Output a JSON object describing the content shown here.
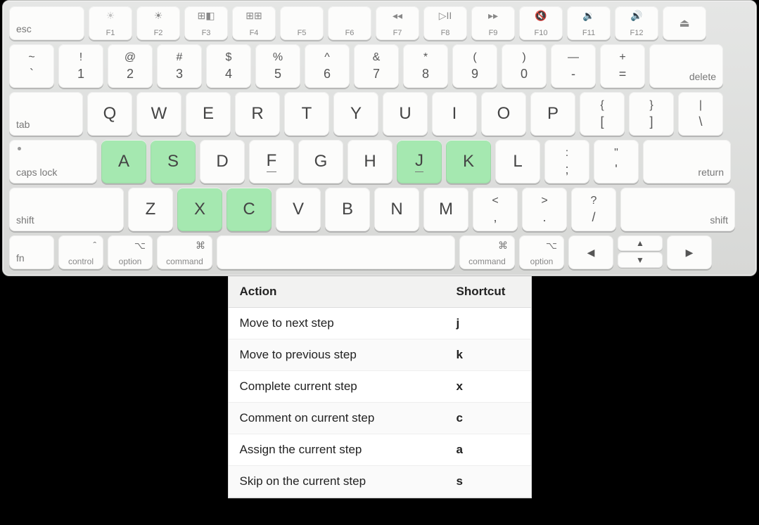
{
  "fn_row": {
    "esc": "esc",
    "keys": [
      {
        "g": "☀︎",
        "dim": true,
        "l": "F1"
      },
      {
        "g": "☀︎",
        "l": "F2"
      },
      {
        "g": "⊞◧",
        "l": "F3"
      },
      {
        "g": "⊞⊞",
        "l": "F4"
      },
      {
        "g": "",
        "l": "F5"
      },
      {
        "g": "",
        "l": "F6"
      },
      {
        "g": "◂◂",
        "l": "F7"
      },
      {
        "g": "▷II",
        "l": "F8"
      },
      {
        "g": "▸▸",
        "l": "F9"
      },
      {
        "g": "🔇",
        "l": "F10"
      },
      {
        "g": "🔉",
        "l": "F11"
      },
      {
        "g": "🔊",
        "l": "F12"
      }
    ],
    "eject": "⏏"
  },
  "num_row": {
    "keys": [
      {
        "t": "~",
        "b": "`"
      },
      {
        "t": "!",
        "b": "1"
      },
      {
        "t": "@",
        "b": "2"
      },
      {
        "t": "#",
        "b": "3"
      },
      {
        "t": "$",
        "b": "4"
      },
      {
        "t": "%",
        "b": "5"
      },
      {
        "t": "^",
        "b": "6"
      },
      {
        "t": "&",
        "b": "7"
      },
      {
        "t": "*",
        "b": "8"
      },
      {
        "t": "(",
        "b": "9"
      },
      {
        "t": ")",
        "b": "0"
      },
      {
        "t": "—",
        "b": "-"
      },
      {
        "t": "+",
        "b": "="
      }
    ],
    "delete": "delete"
  },
  "q_row": {
    "tab": "tab",
    "keys": [
      "Q",
      "W",
      "E",
      "R",
      "T",
      "Y",
      "U",
      "I",
      "O",
      "P"
    ],
    "br1": {
      "t": "{",
      "b": "["
    },
    "br2": {
      "t": "}",
      "b": "]"
    },
    "bs": {
      "t": "|",
      "b": "\\"
    }
  },
  "a_row": {
    "caps": "caps lock",
    "keys": [
      {
        "l": "A",
        "hl": true
      },
      {
        "l": "S",
        "hl": true
      },
      {
        "l": "D"
      },
      {
        "l": "F",
        "u": true
      },
      {
        "l": "G"
      },
      {
        "l": "H"
      },
      {
        "l": "J",
        "hl": true,
        "u": true
      },
      {
        "l": "K",
        "hl": true
      },
      {
        "l": "L"
      }
    ],
    "p1": {
      "t": ":",
      "b": ";"
    },
    "p2": {
      "t": "\"",
      "b": "'"
    },
    "ret": "return"
  },
  "z_row": {
    "shiftL": "shift",
    "keys": [
      {
        "l": "Z"
      },
      {
        "l": "X",
        "hl": true
      },
      {
        "l": "C",
        "hl": true
      },
      {
        "l": "V"
      },
      {
        "l": "B"
      },
      {
        "l": "N"
      },
      {
        "l": "M"
      }
    ],
    "p1": {
      "t": "<",
      "b": ","
    },
    "p2": {
      "t": ">",
      "b": "."
    },
    "p3": {
      "t": "?",
      "b": "/"
    },
    "shiftR": "shift"
  },
  "mod_row": {
    "fn": "fn",
    "ctrl": {
      "g": "ˆ",
      "l": "control"
    },
    "optL": {
      "g": "⌥",
      "l": "option"
    },
    "cmdL": {
      "g": "⌘",
      "l": "command"
    },
    "cmdR": {
      "g": "⌘",
      "l": "command"
    },
    "optR": {
      "g": "⌥",
      "l": "option"
    },
    "arrows": {
      "l": "◀",
      "u": "▲",
      "d": "▼",
      "r": "▶"
    }
  },
  "table": {
    "h1": "Action",
    "h2": "Shortcut",
    "rows": [
      {
        "a": "Move to next step",
        "s": "j"
      },
      {
        "a": "Move to previous step",
        "s": "k"
      },
      {
        "a": "Complete current step",
        "s": "x"
      },
      {
        "a": "Comment on current step",
        "s": "c"
      },
      {
        "a": "Assign the current step",
        "s": "a"
      },
      {
        "a": "Skip on the current step",
        "s": "s"
      }
    ]
  }
}
